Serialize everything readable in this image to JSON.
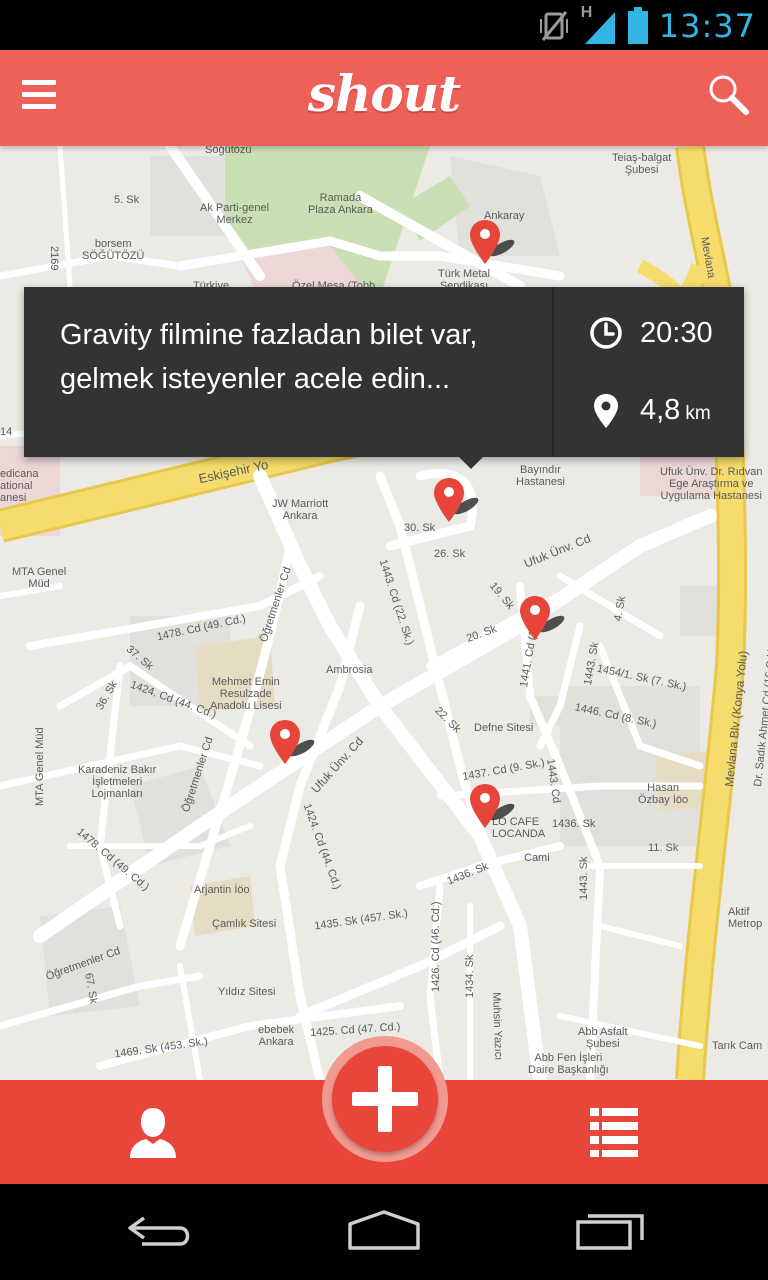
{
  "status_bar": {
    "time": "13:37",
    "network_label": "H",
    "icons": [
      "vibrate-muted-icon",
      "signal-icon",
      "battery-icon"
    ],
    "time_color": "#33b5e5"
  },
  "app_bar": {
    "title": "shout",
    "menu_icon": "hamburger-menu-icon",
    "search_icon": "search-icon",
    "color": "#ee6158"
  },
  "map": {
    "labels": {
      "sogutozu": "Söğütözü",
      "ak_parti": "Ak Parti-genel\nMerkez",
      "borsem": "borsem\nSÖĞÜTÖZÜ",
      "ramada": "Ramada\nPlaza Ankara",
      "ankaray": "Ankaray",
      "turk_metal": "Türk Metal\nSendikası",
      "teias": "Teiaş-balgat\nŞubesi",
      "ozel_mesa": "Özel Mesa (Tobb",
      "turkiye": "Türkiye",
      "five_sk": "5. Sk",
      "mevlana_top": "Mevlana",
      "eskisehir": "Eskişehir Yo",
      "medicana": "edicana\national\nanesi",
      "jw_marriott": "JW Marriott\nAnkara",
      "bayindir": "Bayındır\nHastanesi",
      "ufuk_hastane": "Ufuk Ünv. Dr. Rıdvan\nEge Araştırma ve\nUygulama Hastanesi",
      "mta_genel": "MTA Genel\nMüd",
      "ogretmenler_cd": "Öğretmenler Cd",
      "cd_1478": "1478. Cd (49. Cd.)",
      "sk_37": "37. Sk",
      "sk_36": "36. Sk",
      "sk_1424": "1424. Cd (44. Cd.)",
      "mehmet_emin": "Mehmet Emin\nResulzade\nAnadolu Lisesi",
      "ambrosia": "Ambrosia",
      "cd_1443": "1443. Cd (22. Sk.)",
      "sk_30": "30. Sk",
      "sk_26": "26. Sk",
      "sk_19": "19. Sk",
      "sk_20": "20. Sk",
      "sk_1443": "1443. Sk",
      "cd_1441": "1441. Cd (1.",
      "sk_1454": "1454/1. Sk (7. Sk.)",
      "cd_1446": "1446. Cd (8. Sk.)",
      "sk_4": "4. Sk",
      "ufuk_unv_cd": "Ufuk Ünv. Cd",
      "ufuk_unv_cd2": "Ufuk Ünv. Cd",
      "defne": "Defne Sitesi",
      "karadeniz": "Karadeniz Bakır\nİşletmeleri\nLojmanları",
      "cd_1478b": "1478. Cd (49. Cd.)",
      "cd_1437": "1437. Cd (9. Sk.)",
      "sk_1443b": "1443. Cd",
      "sk_22": "22. Sk",
      "lo_cafe": "LO CAFE\nLOCANDA",
      "sk_1436": "1436. Sk",
      "sk_1436b": "1436. Sk",
      "cami": "Cami",
      "hasan_ozbay": "Hasan\nÖzbay İöo",
      "sk_11": "11. Sk",
      "mevlana_blv": "Mevlana Blv (Konya Yolu)",
      "dr_sadik": "Dr. Sadık Ahmet Cd (16 Cd.)",
      "mta_genel2": "MTA Genel Müd",
      "cd_1424": "1424. Cd (44. Cd.)",
      "arjantin": "Arjantin İöo",
      "camlik": "Çamlık Sitesi",
      "sk_1435": "1435. Sk (457. Sk.)",
      "ogretmenler_cd2": "Öğretmenler Cd",
      "ogretmenler_cd3": "Öğretmenler Cd",
      "sk_67": "67. Sk",
      "yildiz": "Yıldız Sitesi",
      "cd_1426": "1426. Cd (46. Cd.)",
      "sk_1434": "1434. Sk",
      "muhsin": "Muhsin Yazıcı",
      "cd_1425": "1425. Cd (47. Cd.)",
      "sk_1469": "1469. Sk (453. Sk.)",
      "ebebek": "ebebek\nAnkara",
      "abb_asfalt": "Abb Asfalt\nŞubesi",
      "abb_fen": "Abb Fen İşleri\nDaire Başkanlığı",
      "aktif": "Aktif\nMetrop",
      "sk_1443c": "1443. Sk",
      "cd_2169": "2169",
      "sk_14": "14",
      "cd_rb": "Tarık Cam"
    },
    "pins": [
      {
        "name": "event-pin"
      },
      {
        "name": "event-pin"
      },
      {
        "name": "event-pin"
      },
      {
        "name": "event-pin"
      },
      {
        "name": "event-pin"
      }
    ]
  },
  "card": {
    "message": "Gravity filmine fazladan bilet var, gelmek isteyenler acele edin...",
    "time": "20:30",
    "distance": "4,8",
    "distance_unit": "km",
    "time_icon": "clock-icon",
    "distance_icon": "location-pin-icon"
  },
  "bottom_bar": {
    "profile_icon": "person-icon",
    "add_icon": "plus-icon",
    "list_icon": "list-icon",
    "color": "#e9463b"
  },
  "nav_bar": {
    "icons": [
      "back-icon",
      "home-icon",
      "recent-apps-icon"
    ]
  }
}
